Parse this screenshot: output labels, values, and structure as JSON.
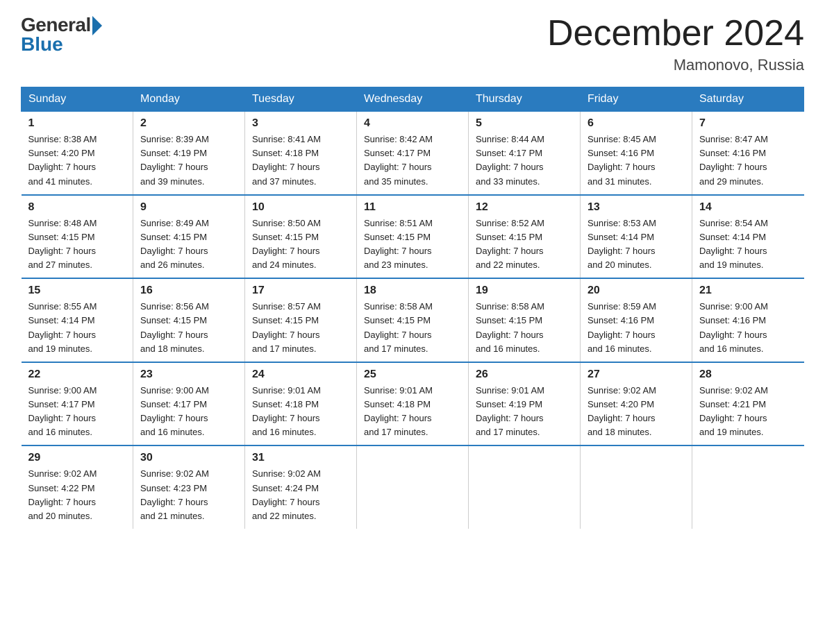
{
  "logo": {
    "general": "General",
    "blue": "Blue"
  },
  "title": "December 2024",
  "location": "Mamonovo, Russia",
  "weekdays": [
    "Sunday",
    "Monday",
    "Tuesday",
    "Wednesday",
    "Thursday",
    "Friday",
    "Saturday"
  ],
  "weeks": [
    [
      {
        "day": "1",
        "info": "Sunrise: 8:38 AM\nSunset: 4:20 PM\nDaylight: 7 hours\nand 41 minutes."
      },
      {
        "day": "2",
        "info": "Sunrise: 8:39 AM\nSunset: 4:19 PM\nDaylight: 7 hours\nand 39 minutes."
      },
      {
        "day": "3",
        "info": "Sunrise: 8:41 AM\nSunset: 4:18 PM\nDaylight: 7 hours\nand 37 minutes."
      },
      {
        "day": "4",
        "info": "Sunrise: 8:42 AM\nSunset: 4:17 PM\nDaylight: 7 hours\nand 35 minutes."
      },
      {
        "day": "5",
        "info": "Sunrise: 8:44 AM\nSunset: 4:17 PM\nDaylight: 7 hours\nand 33 minutes."
      },
      {
        "day": "6",
        "info": "Sunrise: 8:45 AM\nSunset: 4:16 PM\nDaylight: 7 hours\nand 31 minutes."
      },
      {
        "day": "7",
        "info": "Sunrise: 8:47 AM\nSunset: 4:16 PM\nDaylight: 7 hours\nand 29 minutes."
      }
    ],
    [
      {
        "day": "8",
        "info": "Sunrise: 8:48 AM\nSunset: 4:15 PM\nDaylight: 7 hours\nand 27 minutes."
      },
      {
        "day": "9",
        "info": "Sunrise: 8:49 AM\nSunset: 4:15 PM\nDaylight: 7 hours\nand 26 minutes."
      },
      {
        "day": "10",
        "info": "Sunrise: 8:50 AM\nSunset: 4:15 PM\nDaylight: 7 hours\nand 24 minutes."
      },
      {
        "day": "11",
        "info": "Sunrise: 8:51 AM\nSunset: 4:15 PM\nDaylight: 7 hours\nand 23 minutes."
      },
      {
        "day": "12",
        "info": "Sunrise: 8:52 AM\nSunset: 4:15 PM\nDaylight: 7 hours\nand 22 minutes."
      },
      {
        "day": "13",
        "info": "Sunrise: 8:53 AM\nSunset: 4:14 PM\nDaylight: 7 hours\nand 20 minutes."
      },
      {
        "day": "14",
        "info": "Sunrise: 8:54 AM\nSunset: 4:14 PM\nDaylight: 7 hours\nand 19 minutes."
      }
    ],
    [
      {
        "day": "15",
        "info": "Sunrise: 8:55 AM\nSunset: 4:14 PM\nDaylight: 7 hours\nand 19 minutes."
      },
      {
        "day": "16",
        "info": "Sunrise: 8:56 AM\nSunset: 4:15 PM\nDaylight: 7 hours\nand 18 minutes."
      },
      {
        "day": "17",
        "info": "Sunrise: 8:57 AM\nSunset: 4:15 PM\nDaylight: 7 hours\nand 17 minutes."
      },
      {
        "day": "18",
        "info": "Sunrise: 8:58 AM\nSunset: 4:15 PM\nDaylight: 7 hours\nand 17 minutes."
      },
      {
        "day": "19",
        "info": "Sunrise: 8:58 AM\nSunset: 4:15 PM\nDaylight: 7 hours\nand 16 minutes."
      },
      {
        "day": "20",
        "info": "Sunrise: 8:59 AM\nSunset: 4:16 PM\nDaylight: 7 hours\nand 16 minutes."
      },
      {
        "day": "21",
        "info": "Sunrise: 9:00 AM\nSunset: 4:16 PM\nDaylight: 7 hours\nand 16 minutes."
      }
    ],
    [
      {
        "day": "22",
        "info": "Sunrise: 9:00 AM\nSunset: 4:17 PM\nDaylight: 7 hours\nand 16 minutes."
      },
      {
        "day": "23",
        "info": "Sunrise: 9:00 AM\nSunset: 4:17 PM\nDaylight: 7 hours\nand 16 minutes."
      },
      {
        "day": "24",
        "info": "Sunrise: 9:01 AM\nSunset: 4:18 PM\nDaylight: 7 hours\nand 16 minutes."
      },
      {
        "day": "25",
        "info": "Sunrise: 9:01 AM\nSunset: 4:18 PM\nDaylight: 7 hours\nand 17 minutes."
      },
      {
        "day": "26",
        "info": "Sunrise: 9:01 AM\nSunset: 4:19 PM\nDaylight: 7 hours\nand 17 minutes."
      },
      {
        "day": "27",
        "info": "Sunrise: 9:02 AM\nSunset: 4:20 PM\nDaylight: 7 hours\nand 18 minutes."
      },
      {
        "day": "28",
        "info": "Sunrise: 9:02 AM\nSunset: 4:21 PM\nDaylight: 7 hours\nand 19 minutes."
      }
    ],
    [
      {
        "day": "29",
        "info": "Sunrise: 9:02 AM\nSunset: 4:22 PM\nDaylight: 7 hours\nand 20 minutes."
      },
      {
        "day": "30",
        "info": "Sunrise: 9:02 AM\nSunset: 4:23 PM\nDaylight: 7 hours\nand 21 minutes."
      },
      {
        "day": "31",
        "info": "Sunrise: 9:02 AM\nSunset: 4:24 PM\nDaylight: 7 hours\nand 22 minutes."
      },
      {
        "day": "",
        "info": ""
      },
      {
        "day": "",
        "info": ""
      },
      {
        "day": "",
        "info": ""
      },
      {
        "day": "",
        "info": ""
      }
    ]
  ]
}
